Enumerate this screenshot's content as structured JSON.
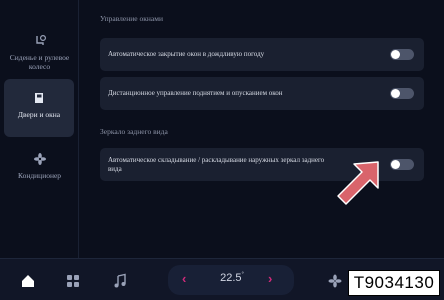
{
  "sidebar": {
    "items": [
      {
        "label": "Сиденье и рулевое колесо",
        "icon": "seat-steering-icon",
        "active": false
      },
      {
        "label": "Двери и окна",
        "icon": "door-icon",
        "active": true
      },
      {
        "label": "Кондиционер",
        "icon": "fan-icon",
        "active": false
      }
    ]
  },
  "main": {
    "windows_section": {
      "title": "Управление окнами",
      "rows": [
        {
          "label": "Автоматическое закрытие окон в дождливую погоду",
          "on": false
        },
        {
          "label": "Дистанционное управление поднятием и опусканием окон",
          "on": false
        }
      ]
    },
    "mirrors_section": {
      "title": "Зеркало заднего вида",
      "rows": [
        {
          "label": "Автоматическое складывание / раскладывание наружных зеркал заднего вида",
          "on": false
        }
      ]
    }
  },
  "bottombar": {
    "icons": [
      "home-icon",
      "apps-grid-icon",
      "music-icon",
      "fan-icon"
    ],
    "temperature": "22.5",
    "temperature_unit": "°"
  },
  "figure_code": "T9034130",
  "colors": {
    "background": "#0b0f1c",
    "card": "#1a2030",
    "toggle_off": "#4d556a",
    "accent_chevron": "#d02a7a",
    "pointer_arrow": "#d9646b"
  }
}
